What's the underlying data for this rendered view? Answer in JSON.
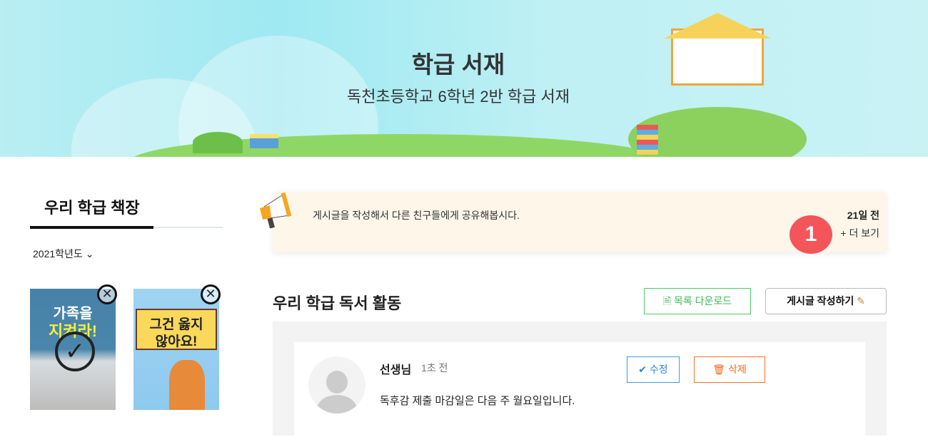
{
  "banner": {
    "title": "학급 서재",
    "subtitle": "독천초등학교 6학년 2반 학급 서재"
  },
  "sidebar": {
    "title": "우리 학급 책장",
    "year_select": "2021학년도",
    "books": [
      {
        "title_line1": "가족을",
        "title_line2": "지켜라!",
        "checked": true
      },
      {
        "title_line1": "그건 옳지",
        "title_line2": "않아요!",
        "checked": false
      }
    ]
  },
  "notice": {
    "text": "게시글을 작성해서 다른 친구들에게 공유해봅시다.",
    "date": "21일 전",
    "more": "+ 더 보기",
    "badge": "1"
  },
  "activity": {
    "title": "우리 학급 독서 활동",
    "download_label": "목록 다운로드",
    "write_label": "게시글 작성하기",
    "posts": [
      {
        "author": "선생님",
        "time": "1초 전",
        "content": "독후감 제출 마감일은 다음 주 월요일입니다.",
        "edit_label": "수정",
        "delete_label": "삭제"
      }
    ]
  },
  "colors": {
    "accent_green": "#3dba5a",
    "edit_blue": "#2a88d6",
    "delete_orange": "#f06a1a",
    "badge_red": "#f4555a"
  }
}
